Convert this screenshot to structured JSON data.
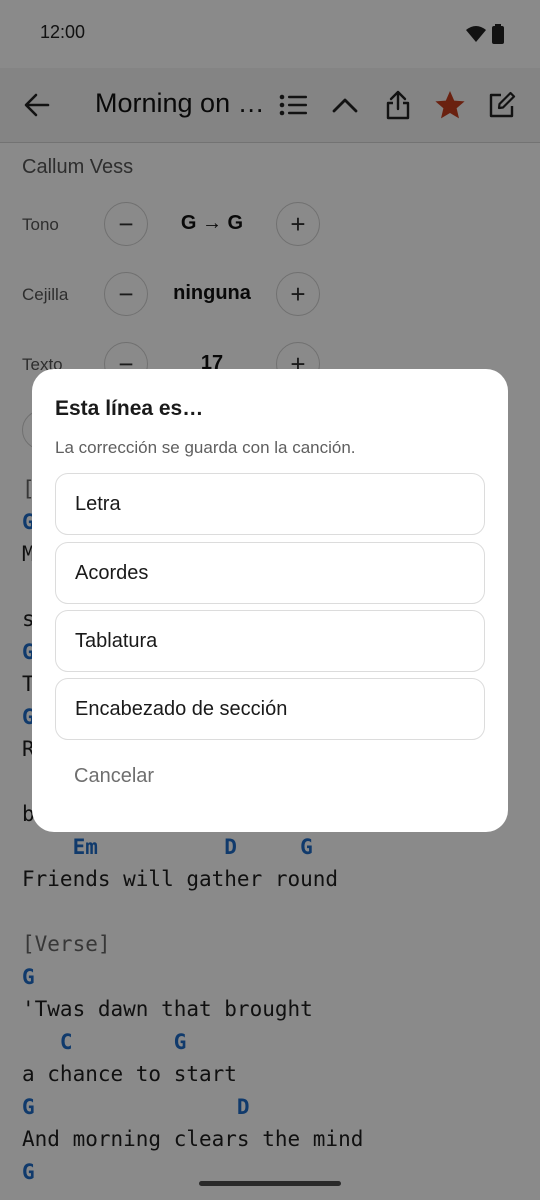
{
  "status_bar": {
    "time": "12:00"
  },
  "header": {
    "title": "Morning on the Ridge",
    "accent": "#c43d1f"
  },
  "song": {
    "artist": "Callum Vess",
    "controls": [
      {
        "label": "Tono",
        "value": "G → G"
      },
      {
        "label": "Cejilla",
        "value": "ninguna"
      },
      {
        "label": "Texto",
        "value": "17"
      }
    ],
    "lines": [
      {
        "kind": "section",
        "text": "["
      },
      {
        "kind": "chord",
        "text": "G"
      },
      {
        "kind": "lyric",
        "text": "M"
      },
      {
        "kind": "blank",
        "text": ""
      },
      {
        "kind": "lyric",
        "text": "s"
      },
      {
        "kind": "chord",
        "text": "G"
      },
      {
        "kind": "lyric",
        "text": "T"
      },
      {
        "kind": "chord",
        "text": "G"
      },
      {
        "kind": "lyric",
        "text": "R"
      },
      {
        "kind": "blank",
        "text": ""
      },
      {
        "kind": "lyric",
        "text": "b"
      },
      {
        "kind": "chord",
        "text": "    Em          D     G"
      },
      {
        "kind": "lyric",
        "text": "Friends will gather round"
      },
      {
        "kind": "blank",
        "text": ""
      },
      {
        "kind": "section",
        "text": "[Verse]"
      },
      {
        "kind": "chord",
        "text": "G"
      },
      {
        "kind": "lyric",
        "text": "'Twas dawn that brought"
      },
      {
        "kind": "chord",
        "text": "   C        G"
      },
      {
        "kind": "lyric",
        "text": "a chance to start"
      },
      {
        "kind": "chord",
        "text": "G                D"
      },
      {
        "kind": "lyric",
        "text": "And morning clears the mind"
      },
      {
        "kind": "chord",
        "text": "G"
      }
    ]
  },
  "dialog": {
    "title": "Esta línea es…",
    "subtitle": "La corrección se guarda con la canción.",
    "options": [
      "Letra",
      "Acordes",
      "Tablatura",
      "Encabezado de sección"
    ],
    "cancel": "Cancelar"
  }
}
